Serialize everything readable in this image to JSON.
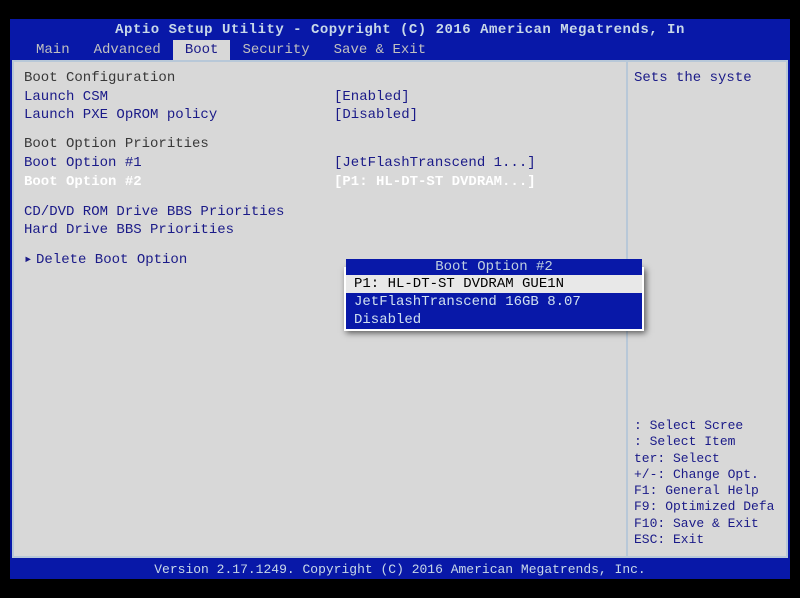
{
  "title": "Aptio Setup Utility - Copyright (C) 2016 American Megatrends, In",
  "tabs": [
    "Main",
    "Advanced",
    "Boot",
    "Security",
    "Save & Exit"
  ],
  "active_tab": "Boot",
  "sections": {
    "boot_config_header": "Boot Configuration",
    "launch_csm_label": "Launch CSM",
    "launch_csm_value": "[Enabled]",
    "launch_pxe_label": "Launch PXE OpROM policy",
    "launch_pxe_value": "[Disabled]",
    "boot_priorities_header": "Boot Option Priorities",
    "boot1_label": "Boot Option #1",
    "boot1_value": "[JetFlashTranscend 1...]",
    "boot2_label": "Boot Option #2",
    "boot2_value": "[P1: HL-DT-ST DVDRAM...]",
    "cddvd_label": "CD/DVD ROM Drive BBS Priorities",
    "hdd_label": "Hard Drive BBS Priorities",
    "delete_label": "Delete Boot Option"
  },
  "popup": {
    "title": "Boot Option #2",
    "items": [
      "P1: HL-DT-ST DVDRAM GUE1N",
      "JetFlashTranscend 16GB 8.07",
      "Disabled"
    ],
    "selected_index": 0
  },
  "help_text": "Sets the syste",
  "key_hints": [
    ": Select Scree",
    ": Select Item",
    "ter: Select",
    "+/-: Change Opt.",
    "F1: General Help",
    "F9: Optimized Defa",
    "F10: Save & Exit",
    "ESC: Exit"
  ],
  "footer": "Version 2.17.1249. Copyright (C) 2016 American Megatrends, Inc."
}
